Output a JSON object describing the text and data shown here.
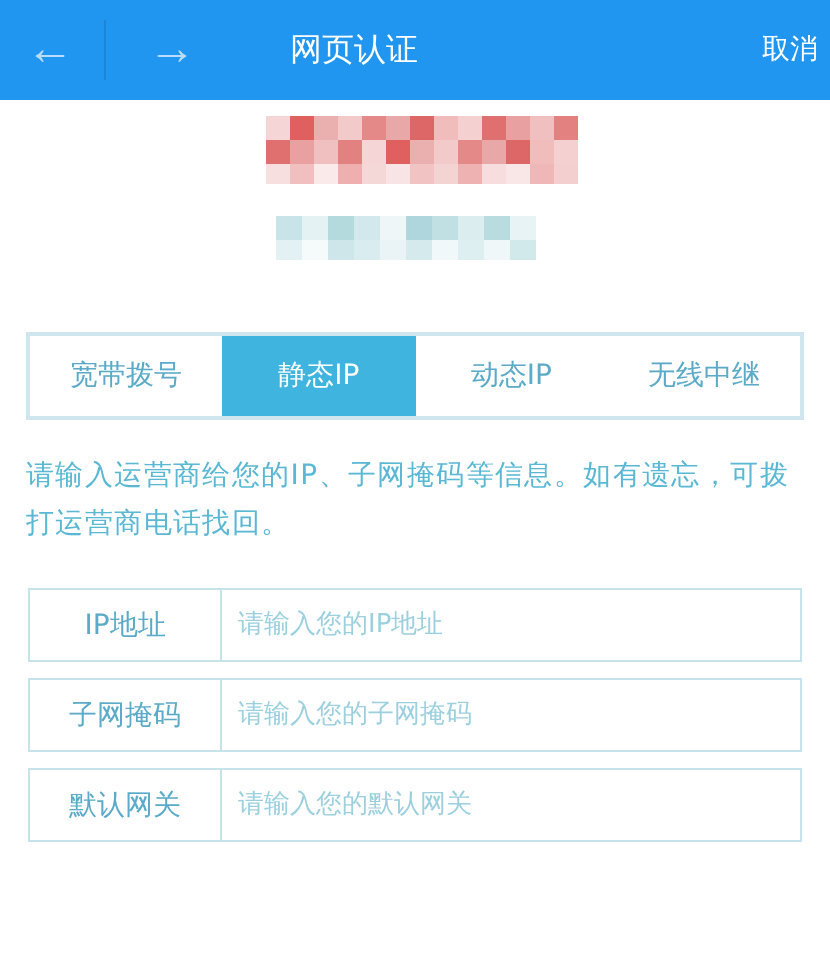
{
  "header": {
    "back": "←",
    "forward": "→",
    "title": "网页认证",
    "cancel": "取消"
  },
  "tabs": [
    {
      "label": "宽带拨号",
      "selected": false
    },
    {
      "label": "静态IP",
      "selected": true
    },
    {
      "label": "动态IP",
      "selected": false
    },
    {
      "label": "无线中继",
      "selected": false
    }
  ],
  "tip": "请输入运营商给您的IP、子网掩码等信息。如有遗忘，可拨打运营商电话找回。",
  "fields": [
    {
      "label": "IP地址",
      "placeholder": "请输入您的IP地址"
    },
    {
      "label": "子网掩码",
      "placeholder": "请输入您的子网掩码"
    },
    {
      "label": "默认网关",
      "placeholder": "请输入您的默认网关"
    }
  ]
}
